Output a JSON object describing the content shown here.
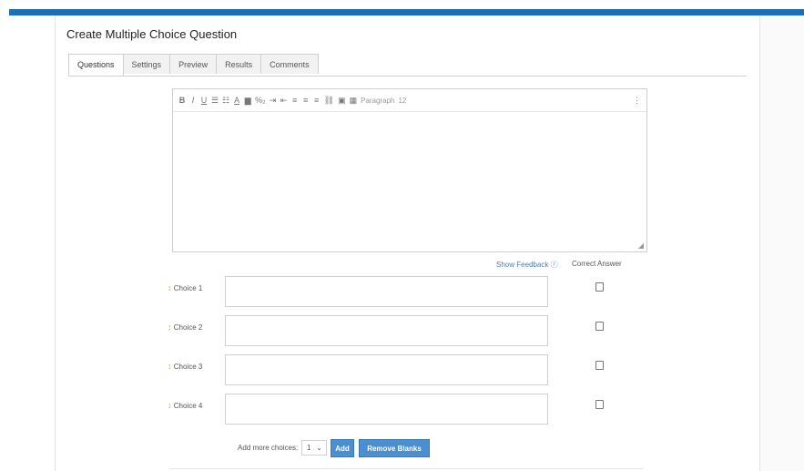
{
  "page": {
    "title": "Create Multiple Choice Question"
  },
  "tabs": [
    {
      "label": "Questions"
    },
    {
      "label": "Settings"
    },
    {
      "label": "Preview"
    },
    {
      "label": "Results"
    },
    {
      "label": "Comments"
    }
  ],
  "toolbar": {
    "bold": "B",
    "italic": "I",
    "underline": "U",
    "ul": "☰",
    "ol": "☷",
    "font_color": "A",
    "bg_color": "▆",
    "special": "%₂",
    "indent": "⇥",
    "outdent": "⇤",
    "align_left": "≡",
    "align_center": "≡",
    "align_right": "≡",
    "link": "⛓",
    "image": "▣",
    "table": "▦",
    "paragraph": "Paragraph",
    "font_size": "12",
    "more": "⋮"
  },
  "feedback_link": "Show Feedback",
  "correct_answer_header": "Correct Answer",
  "choices": [
    {
      "label": "Choice 1"
    },
    {
      "label": "Choice 2"
    },
    {
      "label": "Choice 3"
    },
    {
      "label": "Choice 4"
    }
  ],
  "add_more": {
    "label": "Add more choices:",
    "value": "1"
  },
  "buttons": {
    "add": "Add",
    "remove_blanks": "Remove Blanks"
  }
}
